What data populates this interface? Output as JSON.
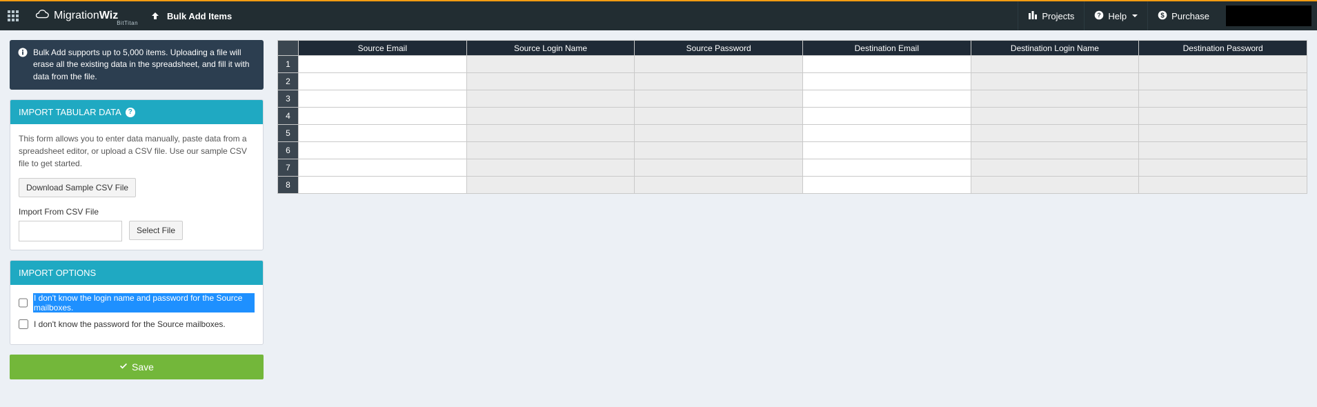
{
  "header": {
    "brand_main": "Migration",
    "brand_bold": "Wiz",
    "brand_sub": "BitTitan",
    "breadcrumb": "Bulk Add Items",
    "nav": {
      "projects": "Projects",
      "help": "Help",
      "purchase": "Purchase"
    }
  },
  "info_banner": "Bulk Add supports up to 5,000 items. Uploading a file will erase all the existing data in the spreadsheet, and fill it with data from the file.",
  "import_panel": {
    "title": "IMPORT TABULAR DATA",
    "desc": "This form allows you to enter data manually, paste data from a spreadsheet editor, or upload a CSV file. Use our sample CSV file to get started.",
    "download_btn": "Download Sample CSV File",
    "file_label": "Import From CSV File",
    "select_btn": "Select File"
  },
  "options_panel": {
    "title": "IMPORT OPTIONS",
    "opt1": "I don't know the login name and password for the Source mailboxes.",
    "opt2": "I don't know the password for the Source mailboxes."
  },
  "save_label": "Save",
  "grid": {
    "columns": [
      "Source Email",
      "Source Login Name",
      "Source Password",
      "Destination Email",
      "Destination Login Name",
      "Destination Password"
    ],
    "disabled_cols": [
      1,
      2,
      4,
      5
    ],
    "rows": 8
  }
}
